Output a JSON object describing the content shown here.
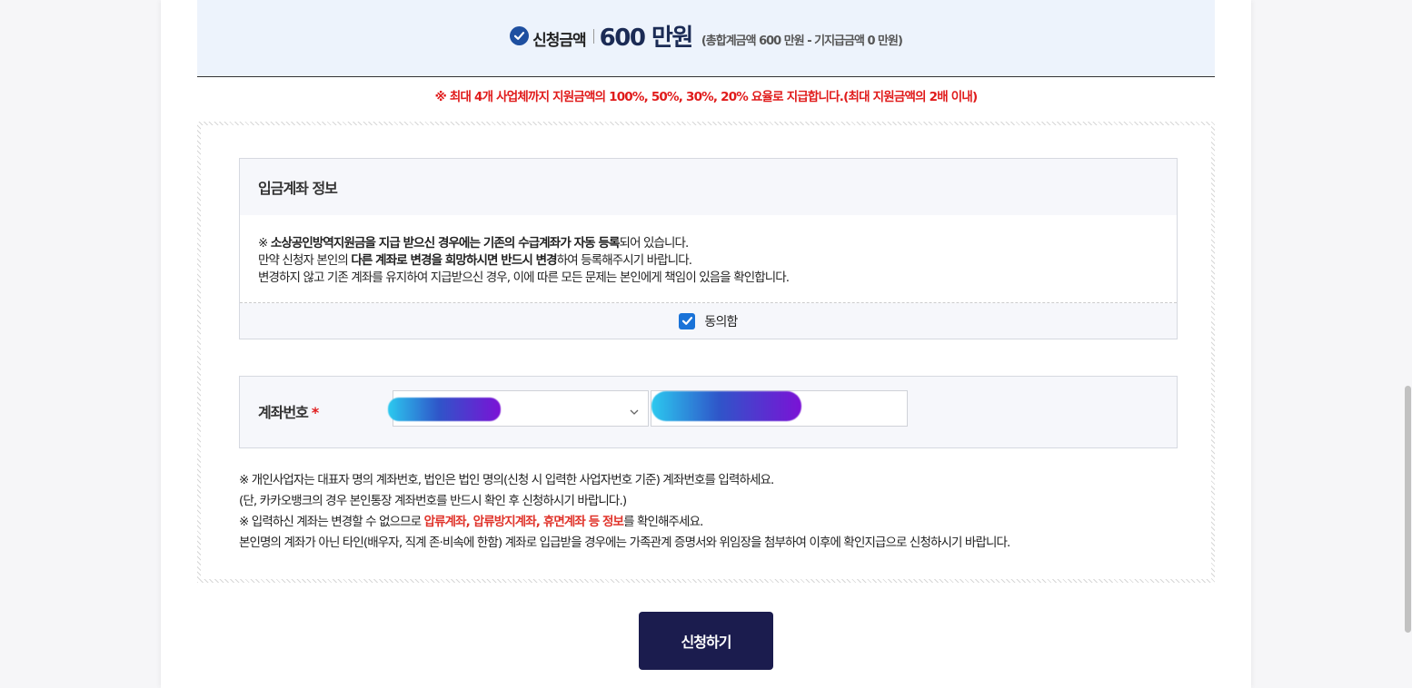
{
  "summary": {
    "label": "신청금액",
    "amount": "600 만원",
    "detail": "(총합계금액 600 만원 - 기지급금액 0 만원)"
  },
  "notice": "※ 최대 4개 사업체까지 지원금액의 100%, 50%, 30%, 20% 요율로 지급합니다.(최대 지원금액의 2배 이내)",
  "account_info": {
    "title": "입금계좌 정보",
    "line1_prefix": "※ ",
    "line1_bold": "소상공인방역지원금을 지급 받으신 경우에는 기존의 수급계좌가 자동 등록",
    "line1_suffix": "되어 있습니다.",
    "line2_a": "만약 신청자 본인의 ",
    "line2_b": "다른 계좌로 변경을 희망하시면 반드시 변경",
    "line2_c": "하여 등록해주시기 바랍니다.",
    "line3": "변경하지 않고 기존 계좌를 유지하여 지급받으신 경우, 이에 따른 모든 문제는 본인에게 책임이 있음을 확인합니다.",
    "agree_label": "동의함",
    "agree_checked": true
  },
  "account_row": {
    "label": "계좌번호",
    "required_mark": "*"
  },
  "guide": {
    "line1": "※ 개인사업자는 대표자 명의 계좌번호, 법인은 법인 명의(신청 시 입력한 사업자번호 기준) 계좌번호를 입력하세요.",
    "line2": "(단, 카카오뱅크의 경우 본인통장 계좌번호를 반드시 확인 후 신청하시기 바랍니다.)",
    "line3_a": "※ 입력하신 계좌는 변경할 수 없으므로 ",
    "line3_b": "압류계좌, 압류방지계좌, 휴면계좌 등 정보",
    "line3_c": "를 확인해주세요.",
    "line4": "본인명의 계좌가 아닌 타인(배우자, 직계 존·비속에 한함) 계좌로 입급받을 경우에는 가족관계 증명서와 위임장을 첨부하여 이후에 확인지급으로 신청하시기 바랍니다."
  },
  "submit_label": "신청하기",
  "colors": {
    "navy": "#1b1c4e",
    "accent_blue": "#1e4fa0",
    "warning_red": "#e01b1b",
    "summary_bg": "#edf3fc"
  }
}
